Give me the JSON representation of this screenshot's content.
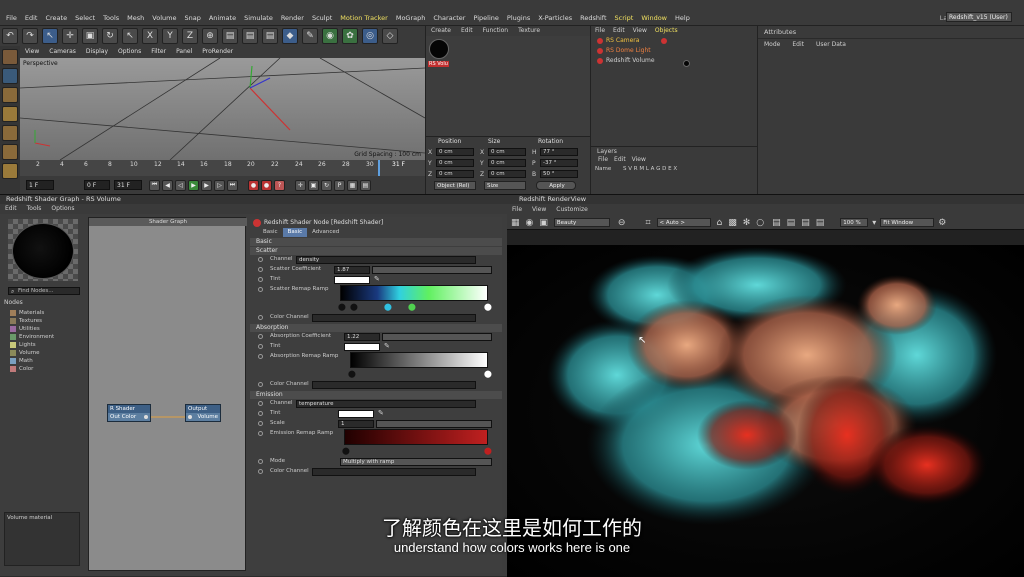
{
  "menubar": {
    "items": [
      "File",
      "Edit",
      "Create",
      "Select",
      "Tools",
      "Mesh",
      "Volume",
      "Snap",
      "Animate",
      "Simulate",
      "Render",
      "Sculpt",
      "Motion Tracker",
      "MoGraph",
      "Character",
      "Pipeline",
      "Plugins",
      "X-Particles",
      "Redshift",
      "Script",
      "Window",
      "Help"
    ],
    "layout_label": "Layout:",
    "layout_value": "Redshift_v15 (User)"
  },
  "toolbar": {
    "axis_x": "X",
    "axis_y": "Y",
    "axis_z": "Z"
  },
  "viewport": {
    "menu": [
      "View",
      "Cameras",
      "Display",
      "Options",
      "Filter",
      "Panel",
      "ProRender"
    ],
    "label": "Perspective",
    "grid_spacing": "Grid Spacing : 100 cm"
  },
  "timeline": {
    "ticks": [
      "2",
      "4",
      "6",
      "8",
      "10",
      "12",
      "14",
      "16",
      "18",
      "20",
      "22",
      "24",
      "26",
      "28",
      "30"
    ],
    "current_frame": "31 F",
    "start_frame": "1 F",
    "frame_field": "0 F",
    "end_frame": "31 F"
  },
  "materials": {
    "tabs": [
      "Create",
      "Edit",
      "Function",
      "Texture"
    ],
    "material_name": "RS Volu"
  },
  "coords": {
    "headers": [
      "Position",
      "Size",
      "Rotation"
    ],
    "rows": [
      {
        "axis": "X",
        "pos": "0 cm",
        "size_axis": "X",
        "size": "0 cm",
        "rot_axis": "H",
        "rot": "77 °"
      },
      {
        "axis": "Y",
        "pos": "0 cm",
        "size_axis": "Y",
        "size": "0 cm",
        "rot_axis": "P",
        "rot": "-37 °"
      },
      {
        "axis": "Z",
        "pos": "0 cm",
        "size_axis": "Z",
        "size": "0 cm",
        "rot_axis": "B",
        "rot": "50 °"
      }
    ],
    "mode": "Object (Rel)",
    "size_mode": "Size",
    "apply": "Apply"
  },
  "objects": {
    "tabs": [
      "File",
      "Edit",
      "View",
      "Objects"
    ],
    "items": [
      {
        "name": "RS Camera",
        "color": "#cc3333"
      },
      {
        "name": "RS Dome Light",
        "color": "#cc3333"
      },
      {
        "name": "Redshift Volume",
        "color": "#cc3333"
      }
    ]
  },
  "layers": {
    "title": "Layers",
    "menu": [
      "File",
      "Edit",
      "View"
    ],
    "name_col": "Name",
    "flags": "S V R M L A G D E X"
  },
  "attributes": {
    "title": "Attributes",
    "menu": [
      "Mode",
      "Edit",
      "User Data"
    ]
  },
  "shader_graph": {
    "window_title": "Redshift Shader Graph - RS Volume",
    "menu": [
      "Edit",
      "Tools",
      "Options"
    ],
    "find_placeholder": "Find Nodes...",
    "nodes_header": "Nodes",
    "node_categories": [
      {
        "label": "Materials",
        "color": "#a07f5a"
      },
      {
        "label": "Textures",
        "color": "#8a7a5a"
      },
      {
        "label": "Utilities",
        "color": "#9a6aa0"
      },
      {
        "label": "Environment",
        "color": "#6a9a6a"
      },
      {
        "label": "Lights",
        "color": "#c8c87a"
      },
      {
        "label": "Volume",
        "color": "#8a8a5a"
      },
      {
        "label": "Math",
        "color": "#7aa0c0"
      },
      {
        "label": "Color",
        "color": "#c07a7a"
      }
    ],
    "graph_title": "Shader Graph",
    "node_rsshader_title": "R Shader",
    "node_rsshader_port": "Out Color",
    "node_output_title": "Output",
    "node_output_port": "Volume",
    "bottom_label": "Volume material"
  },
  "shader_node": {
    "title": "Redshift Shader Node [Redshift Shader]",
    "tabs": [
      "Basic",
      "Basic",
      "Advanced"
    ],
    "section_basic": "Basic",
    "scatter": {
      "header": "Scatter",
      "channel_label": "Channel",
      "channel_value": "density",
      "coeff_label": "Scatter Coefficient",
      "coeff_value": "1.87",
      "tint_label": "Tint",
      "ramp_label": "Scatter Remap Ramp",
      "color_channel_label": "Color Channel"
    },
    "absorption": {
      "header": "Absorption",
      "coeff_label": "Absorption Coefficient",
      "coeff_value": "1.22",
      "tint_label": "Tint",
      "ramp_label": "Absorption Remap Ramp",
      "color_channel_label": "Color Channel"
    },
    "emission": {
      "header": "Emission",
      "channel_label": "Channel",
      "channel_value": "temperature",
      "tint_label": "Tint",
      "scale_label": "Scale",
      "scale_value": "1",
      "ramp_label": "Emission Remap Ramp",
      "mode_label": "Mode",
      "mode_value": "Multiply with ramp",
      "color_channel_label": "Color Channel"
    }
  },
  "render_view": {
    "window_title": "Redshift RenderView",
    "menu": [
      "File",
      "View",
      "Customize"
    ],
    "aov": "Beauty",
    "auto": "< Auto >",
    "zoom": "100 %",
    "fit": "Fit Window"
  },
  "subtitles": {
    "chinese": "了解颜色在这里是如何工作的",
    "english": "understand how colors works here is one"
  }
}
